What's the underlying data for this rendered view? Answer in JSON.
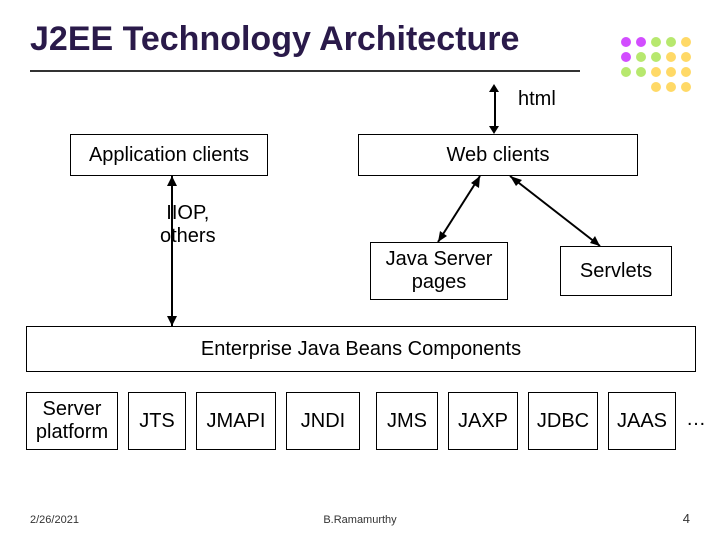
{
  "title": "J2EE Technology Architecture",
  "labels": {
    "html": "html",
    "iiop": "IIOP,\nothers",
    "ellipsis": "…"
  },
  "boxes": {
    "app_clients": "Application clients",
    "web_clients": "Web clients",
    "jsp": "Java Server\npages",
    "servlets": "Servlets",
    "ejb": "Enterprise Java Beans Components",
    "server_platform": "Server\nplatform",
    "jts": "JTS",
    "jmapi": "JMAPI",
    "jndi": "JNDI",
    "jms": "JMS",
    "jaxp": "JAXP",
    "jdbc": "JDBC",
    "jaas": "JAAS"
  },
  "footer": {
    "date": "2/26/2021",
    "author": "B.Ramamurthy",
    "page": "4"
  }
}
